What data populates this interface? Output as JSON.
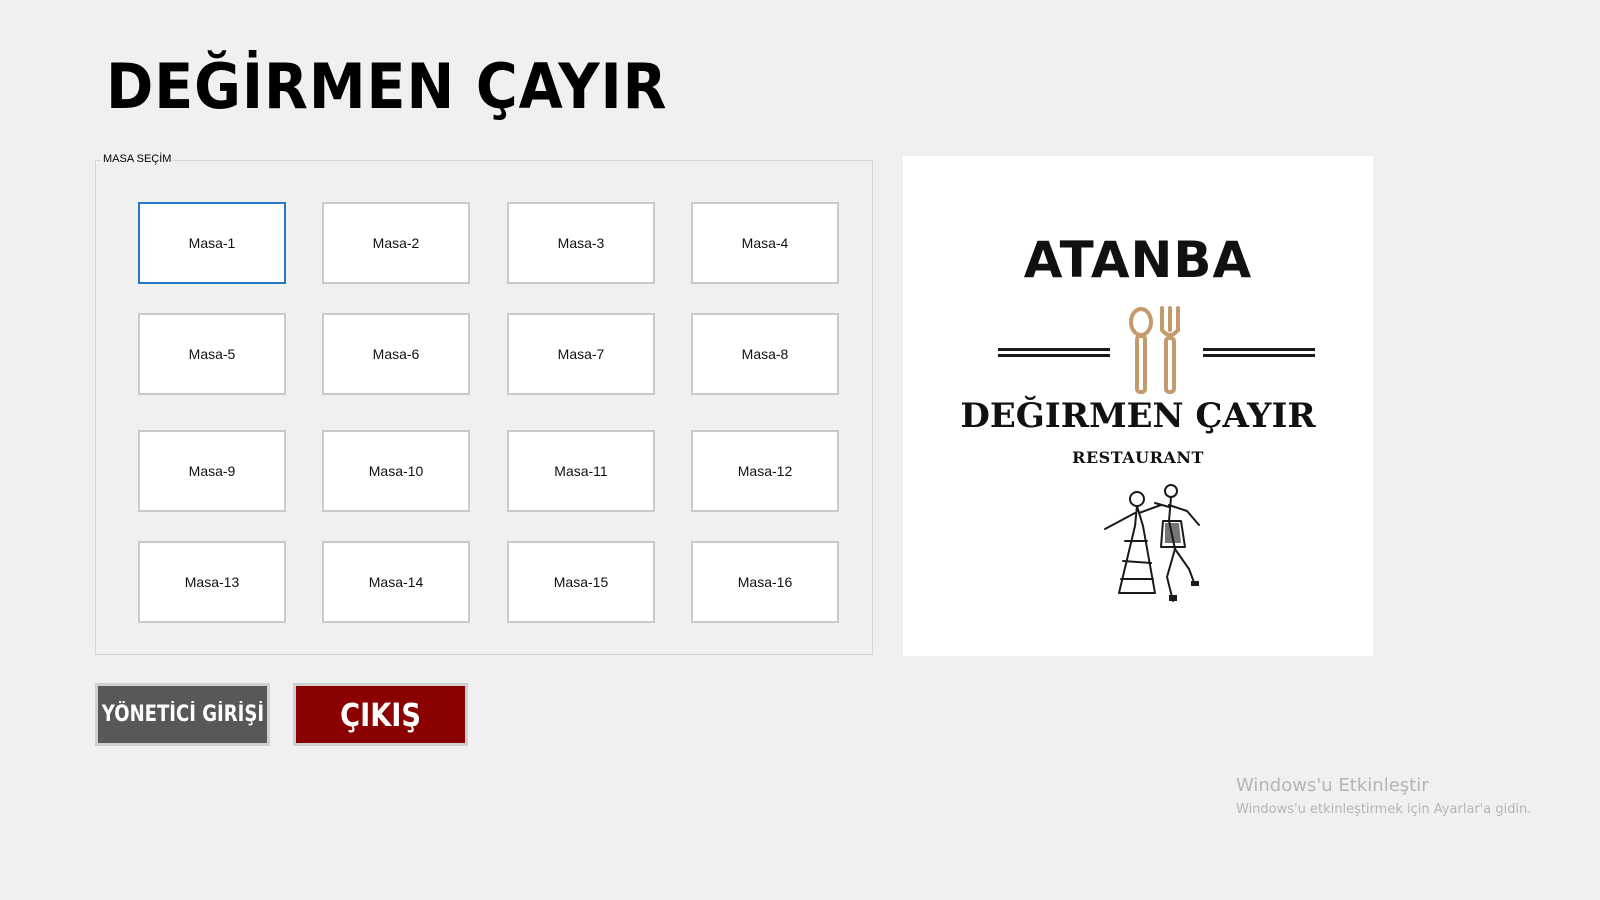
{
  "app": {
    "title": "DEĞİRMEN ÇAYIR"
  },
  "table_selection": {
    "legend": "MASA SEÇİM",
    "selected": "Masa-1",
    "tables": [
      {
        "label": "Masa-1"
      },
      {
        "label": "Masa-2"
      },
      {
        "label": "Masa-3"
      },
      {
        "label": "Masa-4"
      },
      {
        "label": "Masa-5"
      },
      {
        "label": "Masa-6"
      },
      {
        "label": "Masa-7"
      },
      {
        "label": "Masa-8"
      },
      {
        "label": "Masa-9"
      },
      {
        "label": "Masa-10"
      },
      {
        "label": "Masa-11"
      },
      {
        "label": "Masa-12"
      },
      {
        "label": "Masa-13"
      },
      {
        "label": "Masa-14"
      },
      {
        "label": "Masa-15"
      },
      {
        "label": "Masa-16"
      }
    ]
  },
  "logo": {
    "brand": "ATANBA",
    "name": "DEĞIRMEN ÇAYIR",
    "subtitle": "RESTAURANT",
    "icons": [
      "spoon-icon",
      "fork-icon",
      "dancers-icon"
    ],
    "accent_color": "#c49a6c"
  },
  "actions": {
    "admin_label": "YÖNETİCİ GİRİŞİ",
    "exit_label": "ÇIKIŞ",
    "admin_color": "#585858",
    "exit_color": "#8b0000"
  },
  "windows_activation": {
    "title": "Windows'u Etkinleştir",
    "subtitle": "Windows'u etkinleştirmek için Ayarlar'a gidin."
  }
}
